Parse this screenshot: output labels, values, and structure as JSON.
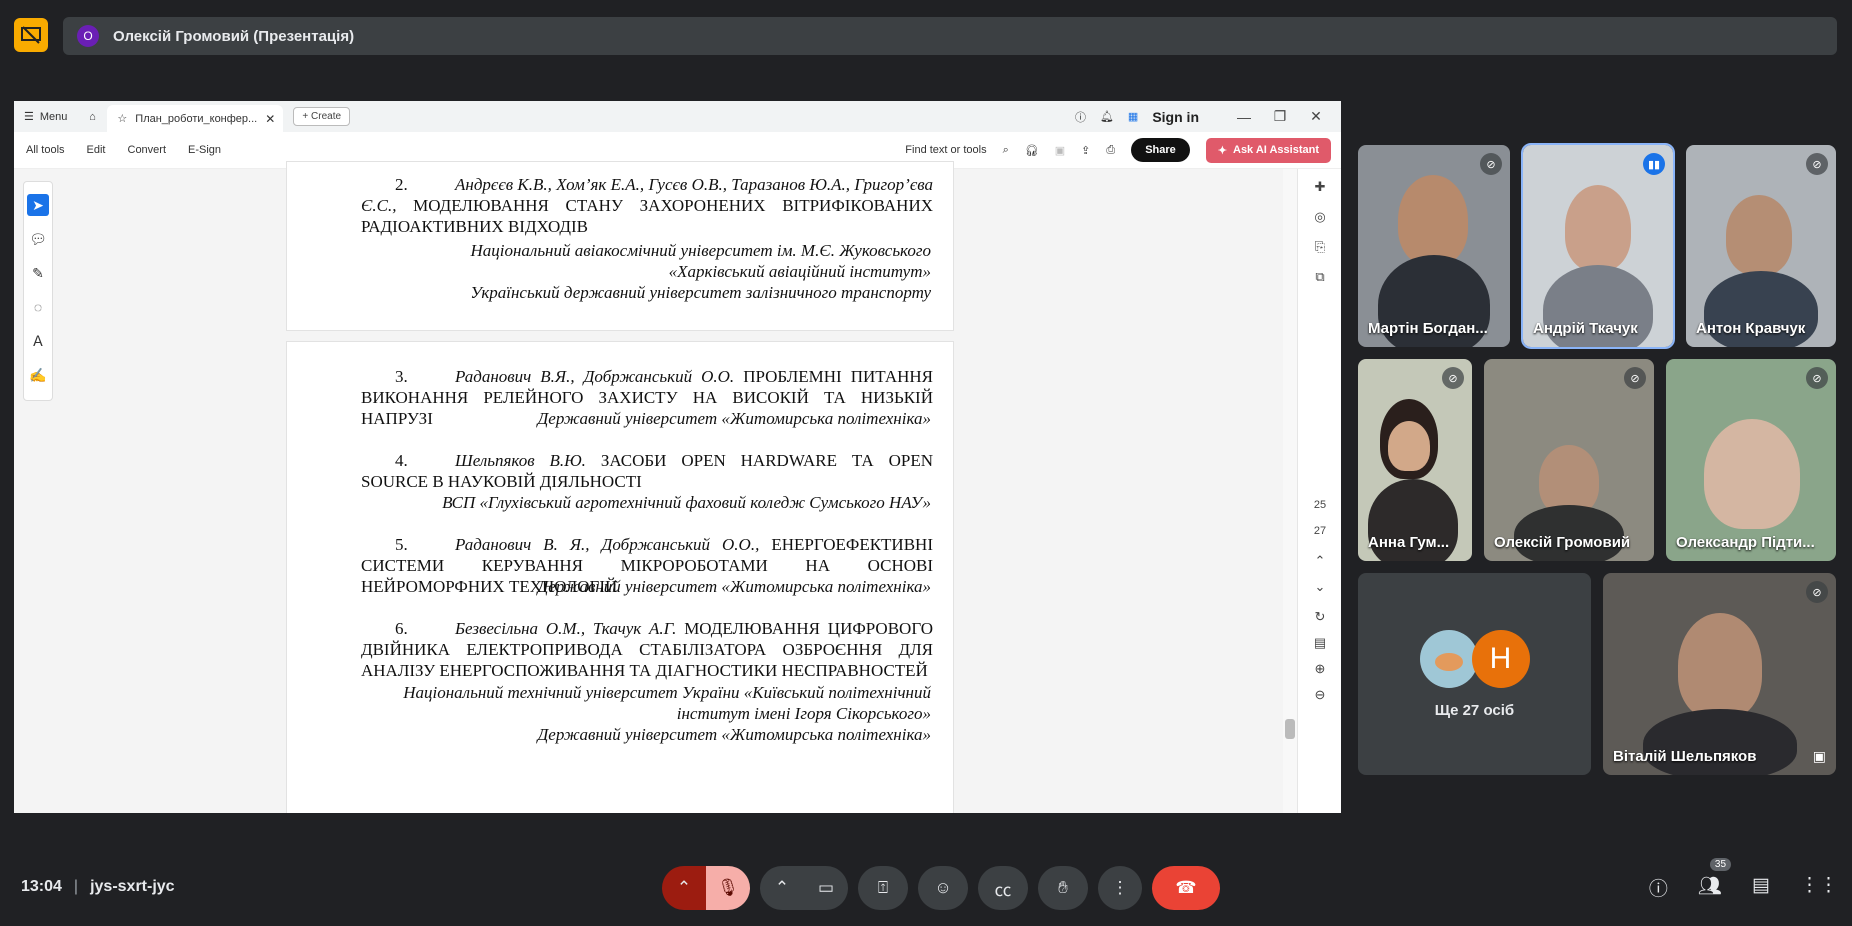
{
  "presenter": {
    "avatar_letter": "О",
    "name": "Олексій Громовий (Презентація)"
  },
  "window": {
    "menu_label": "Menu",
    "tab_title": "План_роботи_конфер...",
    "create_label": "Create",
    "sign_in": "Sign in",
    "menu_items": [
      "All tools",
      "Edit",
      "Convert",
      "E-Sign"
    ],
    "find_label": "Find text or tools",
    "share_label": "Share",
    "ai_label": "Ask AI Assistant",
    "page_numbers": [
      "25",
      "27"
    ]
  },
  "document": {
    "entry2_num": "2.",
    "entry2_authors": "Андрєєв К.В., Хом’як Е.А., Гусєв О.В., Таразанов Ю.А., Григор’єва Є.С.,",
    "entry2_title": "МОДЕЛЮВАННЯ СТАНУ ЗАХОРОНЕНИХ ВІТРИФІКОВАНИХ РАДІОАКТИВНИХ ВІДХОДІВ",
    "entry2_aff1": "Національний авіакосмічний університет ім. М.Є. Жуковського «Харківський авіаційний інститут»",
    "entry2_aff2": "Український державний університет залізничного транспорту",
    "entry3_num": "3.",
    "entry3_authors": "Раданович В.Я., Добржанський О.О.",
    "entry3_title": "ПРОБЛЕМНІ ПИТАННЯ ВИКОНАННЯ РЕЛЕЙНОГО ЗАХИСТУ НА ВИСОКІЙ ТА НИЗЬКІЙ НАПРУЗІ",
    "entry3_aff": "Державний університет «Житомирська політехніка»",
    "entry4_num": "4.",
    "entry4_authors": "Шельпяков В.Ю.",
    "entry4_title": "ЗАСОБИ OPEN HARDWARE ТА OPEN SOURCE В НАУКОВІЙ ДІЯЛЬНОСТІ",
    "entry4_aff": "ВСП «Глухівський агротехнічний фаховий коледж Сумського НАУ»",
    "entry5_num": "5.",
    "entry5_authors": "Раданович В. Я., Добржанський О.О.,",
    "entry5_title": "ЕНЕРГОЕФЕКТИВНІ СИСТЕМИ КЕРУВАННЯ МІКРОРОБОТАМИ НА ОСНОВІ НЕЙРОМОРФНИХ ТЕХНОЛОГІЙ",
    "entry5_aff": "Державний університет «Житомирська політехніка»",
    "entry6_num": "6.",
    "entry6_authors": "Безвесільна О.М., Ткачук А.Г.",
    "entry6_title": "МОДЕЛЮВАННЯ ЦИФРОВОГО ДВІЙНИКА ЕЛЕКТРОПРИВОДА СТАБІЛІЗАТОРА ОЗБРОЄННЯ ДЛЯ АНАЛІЗУ ЕНЕРГОСПОЖИВАННЯ ТА ДІАГНОСТИКИ НЕСПРАВНОСТЕЙ",
    "entry6_aff1": "Національний технічний університет України «Київський політехнічний інститут імені Ігоря Сікорського»",
    "entry6_aff2": "Державний університет «Житомирська політехніка»"
  },
  "participants": [
    "Мартін Богдан...",
    "Андрій Ткачук",
    "Антон Кравчук",
    "Анна Гум...",
    "Олексій Громовий",
    "Олександр Підти...",
    "Віталій Шельпяков"
  ],
  "more": {
    "avatar_letter": "Н",
    "label": "Ще 27 осіб"
  },
  "bottom": {
    "time": "13:04",
    "meeting_code": "jys-sxrt-jyc",
    "people_count": "35"
  }
}
